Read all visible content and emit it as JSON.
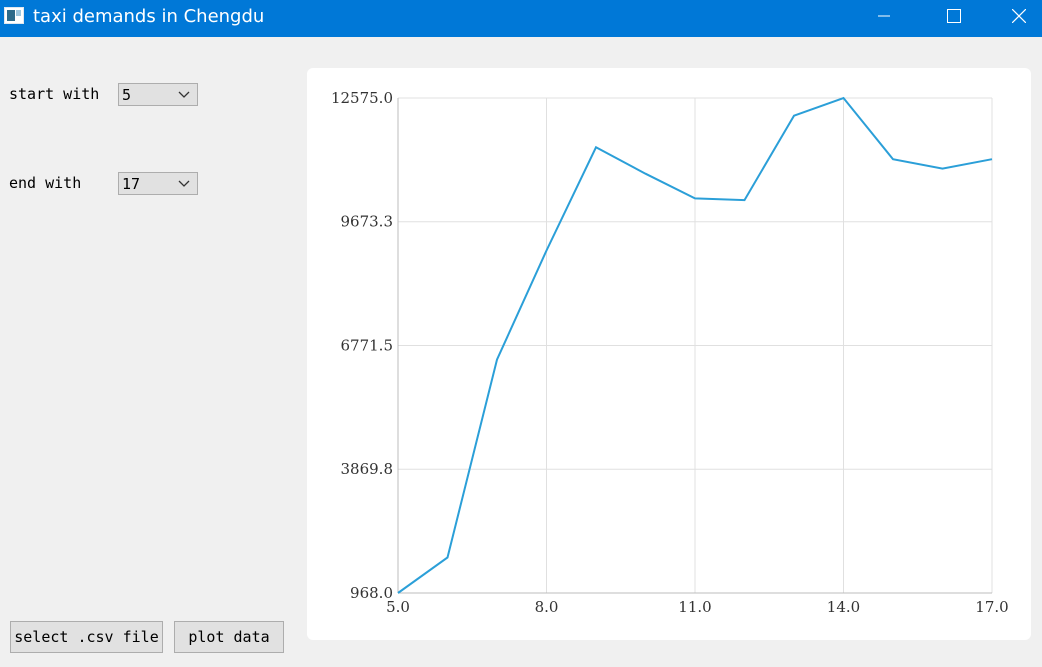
{
  "window": {
    "title": "taxi demands in Chengdu"
  },
  "controls": {
    "start_label": "start with",
    "start_value": "5",
    "end_label": "end with",
    "end_value": "17",
    "select_button": "select .csv file",
    "plot_button": "plot data"
  },
  "colors": {
    "titlebar": "#0078d7",
    "line": "#2b9fd8",
    "grid": "#e0e0e0"
  },
  "chart_data": {
    "type": "line",
    "title": "",
    "xlabel": "",
    "ylabel": "",
    "x": [
      5,
      6,
      7,
      8,
      9,
      10,
      11,
      12,
      13,
      14,
      15,
      16,
      17
    ],
    "series": [
      {
        "values": [
          968.0,
          1800,
          6440,
          9000,
          11420,
          10800,
          10220,
          10180,
          12160,
          12575.0,
          11140,
          10920,
          11140
        ]
      }
    ],
    "xlim": [
      5.0,
      17.0
    ],
    "ylim": [
      968.0,
      12575.0
    ],
    "x_ticks": [
      "5.0",
      "8.0",
      "11.0",
      "14.0",
      "17.0"
    ],
    "y_ticks": [
      "968.0",
      "3869.8",
      "6771.5",
      "9673.3",
      "12575.0"
    ],
    "grid": true,
    "legend": "none"
  }
}
